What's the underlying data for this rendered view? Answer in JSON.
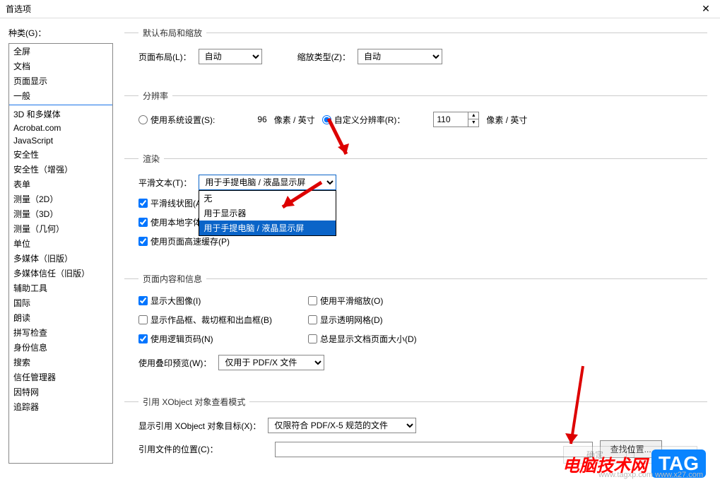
{
  "window": {
    "title": "首选项"
  },
  "sidebar": {
    "label": "种类(G)：",
    "items": [
      "全屏",
      "文档",
      "页面显示",
      "一般",
      "3D 和多媒体",
      "Acrobat.com",
      "JavaScript",
      "安全性",
      "安全性（增强）",
      "表单",
      "测量（2D）",
      "测量（3D）",
      "测量（几何）",
      "单位",
      "多媒体（旧版）",
      "多媒体信任（旧版）",
      "辅助工具",
      "国际",
      "朗读",
      "拼写检查",
      "身份信息",
      "搜索",
      "信任管理器",
      "因特网",
      "追踪器"
    ],
    "selected_index": 2,
    "separator_after_index": 3
  },
  "layout": {
    "legend": "默认布局和缩放",
    "page_layout_label": "页面布局(L)：",
    "page_layout_value": "自动",
    "zoom_type_label": "缩放类型(Z)：",
    "zoom_type_value": "自动"
  },
  "resolution": {
    "legend": "分辨率",
    "use_system_label": "使用系统设置(S):",
    "system_value": "96",
    "px_per_inch": "像素 / 英寸",
    "custom_label": "自定义分辨率(R)：",
    "custom_value": "110",
    "selected": "custom"
  },
  "render": {
    "legend": "渲染",
    "smooth_text_label": "平滑文本(T)：",
    "smooth_text_selected": "用于手提电脑 / 液晶显示屏",
    "options": [
      "无",
      "用于显示器",
      "用于手提电脑 / 液晶显示屏"
    ],
    "smooth_line_label": "平滑线状图(A)",
    "use_local_font_label": "使用本地字体",
    "use_page_cache_label": "使用页面高速缓存(P)"
  },
  "page_content": {
    "legend": "页面内容和信息",
    "show_large_img": "显示大图像(I)",
    "use_smooth_zoom": "使用平滑缩放(O)",
    "show_crop": "显示作品框、裁切框和出血框(B)",
    "show_transparency": "显示透明网格(D)",
    "use_logical_page": "使用逻辑页码(N)",
    "always_show_doc_size": "总是显示文档页面大小(D)",
    "overprint_label": "使用叠印预览(W)：",
    "overprint_value": "仅用于 PDF/X 文件"
  },
  "xobject": {
    "legend": "引用 XObject 对象查看模式",
    "show_target_label": "显示引用 XObject 对象目标(X)：",
    "show_target_value": "仅限符合 PDF/X-5 规范的文件",
    "ref_file_loc_label": "引用文件的位置(C)：",
    "ref_file_loc_value": "",
    "find_loc_button": "查找位置..."
  },
  "footer": {
    "ok": "确定",
    "cancel": "取消"
  },
  "watermark": {
    "text": "电脑技术网",
    "tag": "TAG",
    "url": "www.tagxp.com  www.x27.com"
  }
}
